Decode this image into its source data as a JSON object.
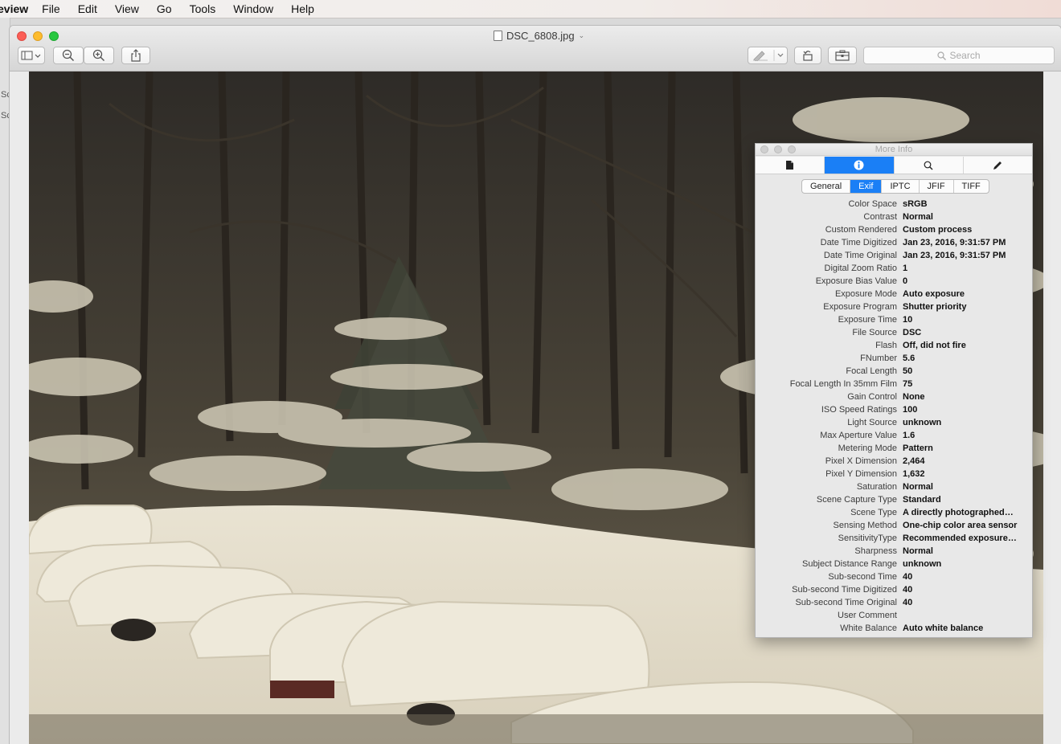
{
  "menubar": {
    "app": "eview",
    "items": [
      "File",
      "Edit",
      "View",
      "Go",
      "Tools",
      "Window",
      "Help"
    ]
  },
  "window": {
    "title": "DSC_6808.jpg",
    "search_placeholder": "Search"
  },
  "left_edge": [
    "Sc",
    "Sc"
  ],
  "icons": {
    "sidebar": "sidebar-icon",
    "zoom_out": "zoom-out-icon",
    "zoom_in": "zoom-in-icon",
    "share": "share-icon",
    "markup": "pen-icon",
    "rotate": "rotate-icon",
    "toolbox": "toolbox-icon"
  },
  "panel": {
    "title": "More Info",
    "icon_tabs": [
      "document-icon",
      "info-icon",
      "search-icon",
      "pencil-icon"
    ],
    "active_icon_tab": 1,
    "tabs": [
      "General",
      "Exif",
      "IPTC",
      "JFIF",
      "TIFF"
    ],
    "active_tab": 1,
    "rows": [
      {
        "k": "Color Space",
        "v": "sRGB"
      },
      {
        "k": "Contrast",
        "v": "Normal"
      },
      {
        "k": "Custom Rendered",
        "v": "Custom process"
      },
      {
        "k": "Date Time Digitized",
        "v": "Jan 23, 2016, 9:31:57 PM"
      },
      {
        "k": "Date Time Original",
        "v": "Jan 23, 2016, 9:31:57 PM"
      },
      {
        "k": "Digital Zoom Ratio",
        "v": "1"
      },
      {
        "k": "Exposure Bias Value",
        "v": "0"
      },
      {
        "k": "Exposure Mode",
        "v": "Auto exposure"
      },
      {
        "k": "Exposure Program",
        "v": "Shutter priority"
      },
      {
        "k": "Exposure Time",
        "v": "10"
      },
      {
        "k": "File Source",
        "v": "DSC"
      },
      {
        "k": "Flash",
        "v": "Off, did not fire"
      },
      {
        "k": "FNumber",
        "v": "5.6"
      },
      {
        "k": "Focal Length",
        "v": "50"
      },
      {
        "k": "Focal Length In 35mm Film",
        "v": "75"
      },
      {
        "k": "Gain Control",
        "v": "None"
      },
      {
        "k": "ISO Speed Ratings",
        "v": "100"
      },
      {
        "k": "Light Source",
        "v": "unknown"
      },
      {
        "k": "Max Aperture Value",
        "v": "1.6"
      },
      {
        "k": "Metering Mode",
        "v": "Pattern"
      },
      {
        "k": "Pixel X Dimension",
        "v": "2,464"
      },
      {
        "k": "Pixel Y Dimension",
        "v": "1,632"
      },
      {
        "k": "Saturation",
        "v": "Normal"
      },
      {
        "k": "Scene Capture Type",
        "v": "Standard"
      },
      {
        "k": "Scene Type",
        "v": "A directly photographed…"
      },
      {
        "k": "Sensing Method",
        "v": "One-chip color area sensor"
      },
      {
        "k": "SensitivityType",
        "v": "Recommended exposure…"
      },
      {
        "k": "Sharpness",
        "v": "Normal"
      },
      {
        "k": "Subject Distance Range",
        "v": "unknown"
      },
      {
        "k": "Sub-second Time",
        "v": "40"
      },
      {
        "k": "Sub-second Time Digitized",
        "v": "40"
      },
      {
        "k": "Sub-second Time Original",
        "v": "40"
      },
      {
        "k": "User Comment",
        "v": ""
      },
      {
        "k": "White Balance",
        "v": "Auto white balance"
      }
    ]
  }
}
